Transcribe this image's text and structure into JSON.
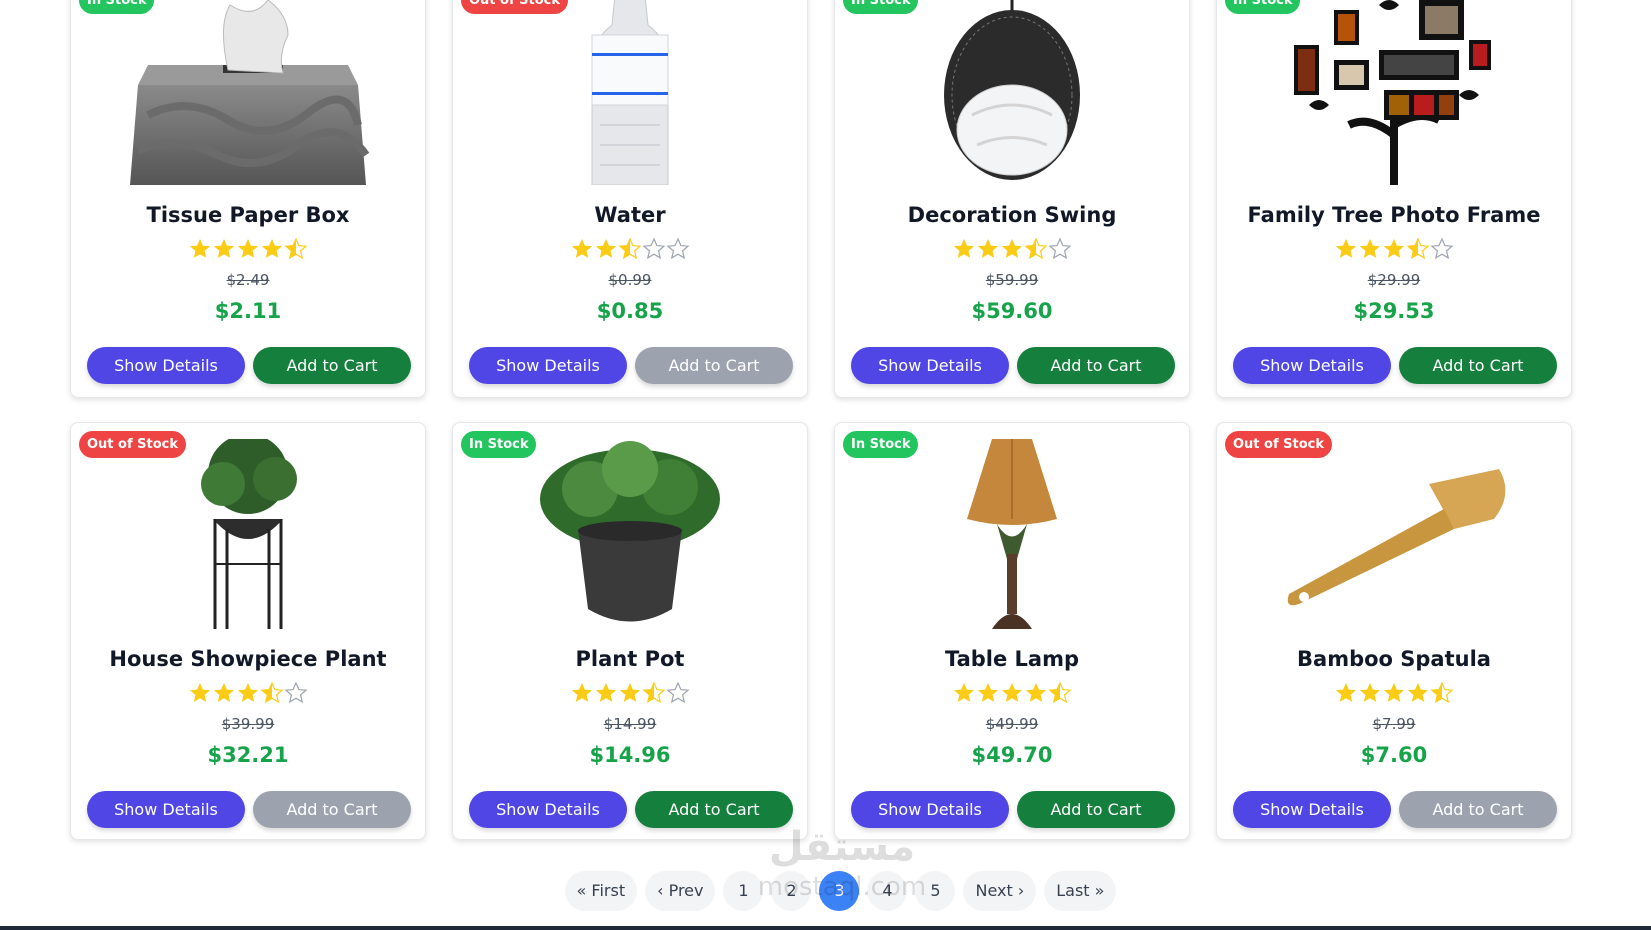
{
  "products": [
    {
      "name": "Tissue Paper Box",
      "stock": "In Stock",
      "in_stock": true,
      "rating": 4.5,
      "old_price": "$2.49",
      "price": "$2.11",
      "details_label": "Show Details",
      "cart_label": "Add to Cart",
      "image_icon": "tissue-box-icon"
    },
    {
      "name": "Water",
      "stock": "Out of Stock",
      "in_stock": false,
      "rating": 2.5,
      "old_price": "$0.99",
      "price": "$0.85",
      "details_label": "Show Details",
      "cart_label": "Add to Cart",
      "image_icon": "water-bottle-icon"
    },
    {
      "name": "Decoration Swing",
      "stock": "In Stock",
      "in_stock": true,
      "rating": 3.5,
      "old_price": "$59.99",
      "price": "$59.60",
      "details_label": "Show Details",
      "cart_label": "Add to Cart",
      "image_icon": "swing-chair-icon"
    },
    {
      "name": "Family Tree Photo Frame",
      "stock": "In Stock",
      "in_stock": true,
      "rating": 3.5,
      "old_price": "$29.99",
      "price": "$29.53",
      "details_label": "Show Details",
      "cart_label": "Add to Cart",
      "image_icon": "photo-frame-tree-icon"
    },
    {
      "name": "House Showpiece Plant",
      "stock": "Out of Stock",
      "in_stock": false,
      "rating": 3.5,
      "old_price": "$39.99",
      "price": "$32.21",
      "details_label": "Show Details",
      "cart_label": "Add to Cart",
      "image_icon": "plant-stand-icon"
    },
    {
      "name": "Plant Pot",
      "stock": "In Stock",
      "in_stock": true,
      "rating": 3.5,
      "old_price": "$14.99",
      "price": "$14.96",
      "details_label": "Show Details",
      "cart_label": "Add to Cart",
      "image_icon": "plant-pot-icon"
    },
    {
      "name": "Table Lamp",
      "stock": "In Stock",
      "in_stock": true,
      "rating": 4.5,
      "old_price": "$49.99",
      "price": "$49.70",
      "details_label": "Show Details",
      "cart_label": "Add to Cart",
      "image_icon": "table-lamp-icon"
    },
    {
      "name": "Bamboo Spatula",
      "stock": "Out of Stock",
      "in_stock": false,
      "rating": 4.5,
      "old_price": "$7.99",
      "price": "$7.60",
      "details_label": "Show Details",
      "cart_label": "Add to Cart",
      "image_icon": "spatula-icon"
    }
  ],
  "pagination": {
    "first": "« First",
    "prev": "‹ Prev",
    "pages": [
      "1",
      "2",
      "3",
      "4",
      "5"
    ],
    "current": "3",
    "next": "Next ›",
    "last": "Last »"
  },
  "colors": {
    "in_stock": "#22c55e",
    "out_of_stock": "#ef4444",
    "details_button": "#4f46e5",
    "cart_button": "#15803d",
    "cart_disabled": "#9ca3af",
    "price": "#16a34a",
    "star": "#facc15",
    "active_page": "#3b82f6"
  },
  "watermark": "mostaql.com"
}
